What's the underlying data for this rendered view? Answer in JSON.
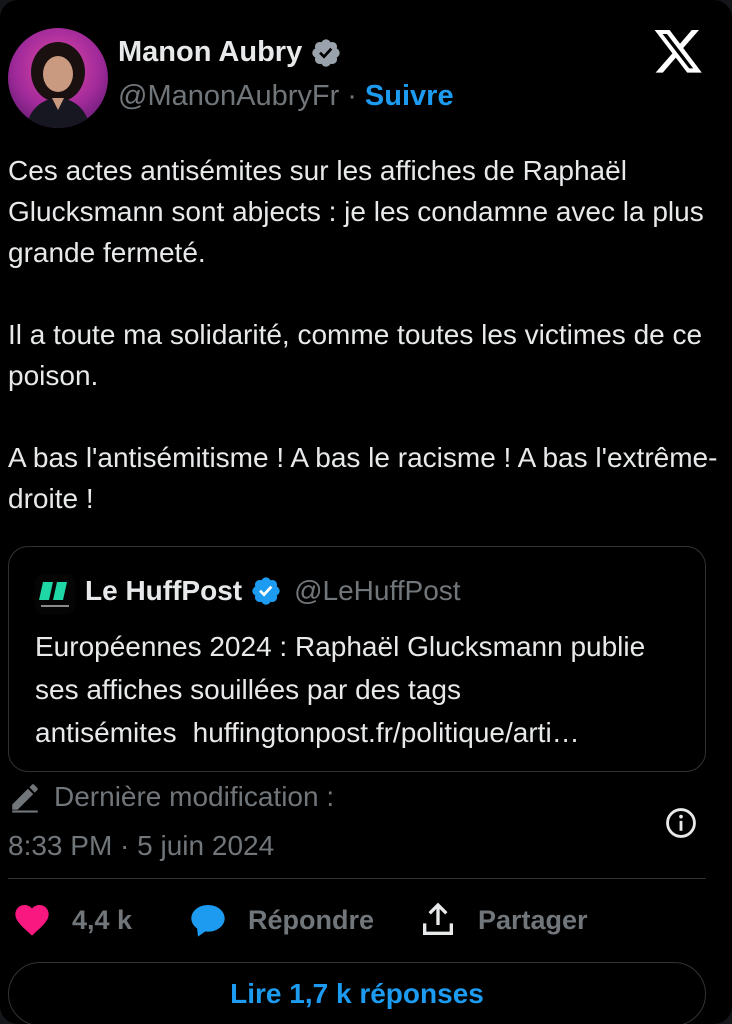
{
  "author": {
    "name": "Manon Aubry",
    "handle": "@ManonAubryFr",
    "separator": "·",
    "follow_label": "Suivre"
  },
  "tweet": {
    "paragraphs": [
      "Ces actes antisémites sur les affiches de Raphaël Glucksmann sont abjects : je les condamne avec la plus grande fermeté.",
      "Il a toute ma solidarité, comme toutes les victimes de ce poison.",
      "A bas l'antisémitisme ! A bas le racisme ! A bas l'extrême-droite !"
    ]
  },
  "quote": {
    "name": "Le HuffPost",
    "handle": "@LeHuffPost",
    "text": "Européennes 2024 : Raphaël Glucksmann publie ses affiches souillées par des tags antisémites",
    "link": "huffingtonpost.fr/politique/arti…"
  },
  "meta": {
    "edit_label": "Dernière modification :",
    "timestamp": "8:33 PM · 5 juin 2024"
  },
  "actions": {
    "likes": "4,4 k",
    "reply_label": "Répondre",
    "share_label": "Partager"
  },
  "read_replies_label": "Lire 1,7 k réponses",
  "icons": [
    "x-logo-icon",
    "verified-icon",
    "huffpost-logo-icon",
    "pencil-icon",
    "info-icon",
    "heart-icon",
    "reply-icon",
    "share-icon"
  ],
  "colors": {
    "accent": "#1d9bf0",
    "like": "#f91880",
    "muted": "#71767b",
    "text": "#e7e9ea",
    "background": "#000000",
    "border": "#2f3336",
    "huffpost": "#1fd6a5"
  }
}
